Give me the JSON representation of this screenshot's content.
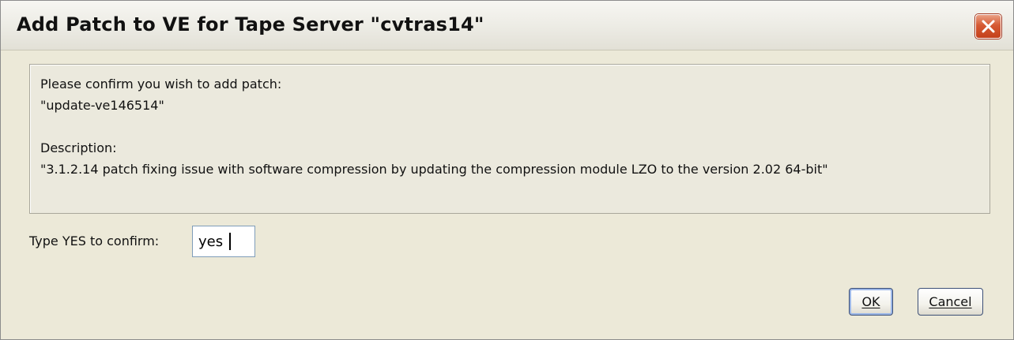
{
  "dialog": {
    "title": "Add Patch to VE for Tape Server \"cvtras14\"",
    "close_icon": "close-icon"
  },
  "message": {
    "prompt": "Please confirm you wish to add patch:",
    "patch_name": "\"update-ve146514\"",
    "description_label": "Description:",
    "description_text": "\"3.1.2.14 patch fixing issue with software compression by updating the compression module LZO to the version 2.02 64-bit\""
  },
  "confirm": {
    "label": "Type YES to confirm:",
    "value": "yes"
  },
  "buttons": {
    "ok": "OK",
    "cancel": "Cancel"
  },
  "colors": {
    "window_background": "#ece9d8",
    "close_button": "#d65a33",
    "default_button_border": "#9db8e8"
  }
}
